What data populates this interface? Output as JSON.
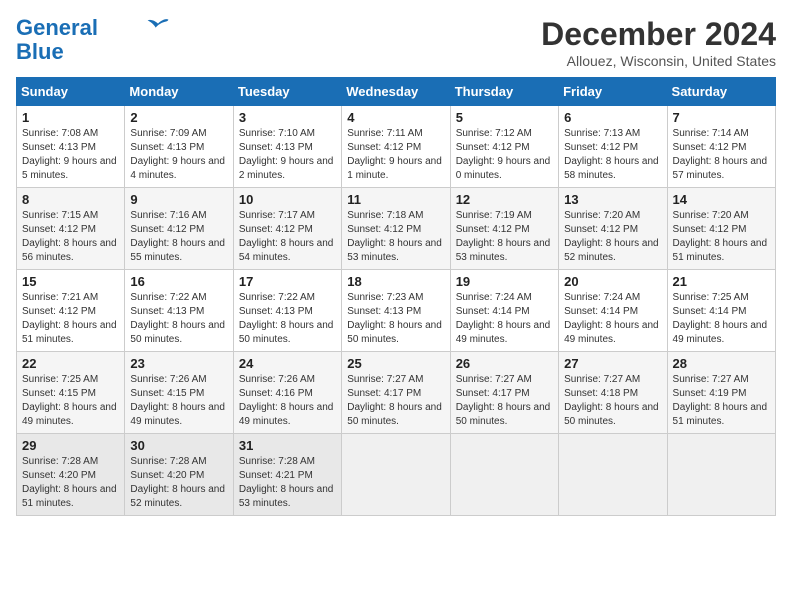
{
  "logo": {
    "line1": "General",
    "line2": "Blue"
  },
  "header": {
    "title": "December 2024",
    "location": "Allouez, Wisconsin, United States"
  },
  "weekdays": [
    "Sunday",
    "Monday",
    "Tuesday",
    "Wednesday",
    "Thursday",
    "Friday",
    "Saturday"
  ],
  "weeks": [
    [
      {
        "day": "1",
        "sunrise": "7:08 AM",
        "sunset": "4:13 PM",
        "daylight": "9 hours and 5 minutes."
      },
      {
        "day": "2",
        "sunrise": "7:09 AM",
        "sunset": "4:13 PM",
        "daylight": "9 hours and 4 minutes."
      },
      {
        "day": "3",
        "sunrise": "7:10 AM",
        "sunset": "4:13 PM",
        "daylight": "9 hours and 2 minutes."
      },
      {
        "day": "4",
        "sunrise": "7:11 AM",
        "sunset": "4:12 PM",
        "daylight": "9 hours and 1 minute."
      },
      {
        "day": "5",
        "sunrise": "7:12 AM",
        "sunset": "4:12 PM",
        "daylight": "9 hours and 0 minutes."
      },
      {
        "day": "6",
        "sunrise": "7:13 AM",
        "sunset": "4:12 PM",
        "daylight": "8 hours and 58 minutes."
      },
      {
        "day": "7",
        "sunrise": "7:14 AM",
        "sunset": "4:12 PM",
        "daylight": "8 hours and 57 minutes."
      }
    ],
    [
      {
        "day": "8",
        "sunrise": "7:15 AM",
        "sunset": "4:12 PM",
        "daylight": "8 hours and 56 minutes."
      },
      {
        "day": "9",
        "sunrise": "7:16 AM",
        "sunset": "4:12 PM",
        "daylight": "8 hours and 55 minutes."
      },
      {
        "day": "10",
        "sunrise": "7:17 AM",
        "sunset": "4:12 PM",
        "daylight": "8 hours and 54 minutes."
      },
      {
        "day": "11",
        "sunrise": "7:18 AM",
        "sunset": "4:12 PM",
        "daylight": "8 hours and 53 minutes."
      },
      {
        "day": "12",
        "sunrise": "7:19 AM",
        "sunset": "4:12 PM",
        "daylight": "8 hours and 53 minutes."
      },
      {
        "day": "13",
        "sunrise": "7:20 AM",
        "sunset": "4:12 PM",
        "daylight": "8 hours and 52 minutes."
      },
      {
        "day": "14",
        "sunrise": "7:20 AM",
        "sunset": "4:12 PM",
        "daylight": "8 hours and 51 minutes."
      }
    ],
    [
      {
        "day": "15",
        "sunrise": "7:21 AM",
        "sunset": "4:12 PM",
        "daylight": "8 hours and 51 minutes."
      },
      {
        "day": "16",
        "sunrise": "7:22 AM",
        "sunset": "4:13 PM",
        "daylight": "8 hours and 50 minutes."
      },
      {
        "day": "17",
        "sunrise": "7:22 AM",
        "sunset": "4:13 PM",
        "daylight": "8 hours and 50 minutes."
      },
      {
        "day": "18",
        "sunrise": "7:23 AM",
        "sunset": "4:13 PM",
        "daylight": "8 hours and 50 minutes."
      },
      {
        "day": "19",
        "sunrise": "7:24 AM",
        "sunset": "4:14 PM",
        "daylight": "8 hours and 49 minutes."
      },
      {
        "day": "20",
        "sunrise": "7:24 AM",
        "sunset": "4:14 PM",
        "daylight": "8 hours and 49 minutes."
      },
      {
        "day": "21",
        "sunrise": "7:25 AM",
        "sunset": "4:14 PM",
        "daylight": "8 hours and 49 minutes."
      }
    ],
    [
      {
        "day": "22",
        "sunrise": "7:25 AM",
        "sunset": "4:15 PM",
        "daylight": "8 hours and 49 minutes."
      },
      {
        "day": "23",
        "sunrise": "7:26 AM",
        "sunset": "4:15 PM",
        "daylight": "8 hours and 49 minutes."
      },
      {
        "day": "24",
        "sunrise": "7:26 AM",
        "sunset": "4:16 PM",
        "daylight": "8 hours and 49 minutes."
      },
      {
        "day": "25",
        "sunrise": "7:27 AM",
        "sunset": "4:17 PM",
        "daylight": "8 hours and 50 minutes."
      },
      {
        "day": "26",
        "sunrise": "7:27 AM",
        "sunset": "4:17 PM",
        "daylight": "8 hours and 50 minutes."
      },
      {
        "day": "27",
        "sunrise": "7:27 AM",
        "sunset": "4:18 PM",
        "daylight": "8 hours and 50 minutes."
      },
      {
        "day": "28",
        "sunrise": "7:27 AM",
        "sunset": "4:19 PM",
        "daylight": "8 hours and 51 minutes."
      }
    ],
    [
      {
        "day": "29",
        "sunrise": "7:28 AM",
        "sunset": "4:20 PM",
        "daylight": "8 hours and 51 minutes."
      },
      {
        "day": "30",
        "sunrise": "7:28 AM",
        "sunset": "4:20 PM",
        "daylight": "8 hours and 52 minutes."
      },
      {
        "day": "31",
        "sunrise": "7:28 AM",
        "sunset": "4:21 PM",
        "daylight": "8 hours and 53 minutes."
      },
      null,
      null,
      null,
      null
    ]
  ]
}
